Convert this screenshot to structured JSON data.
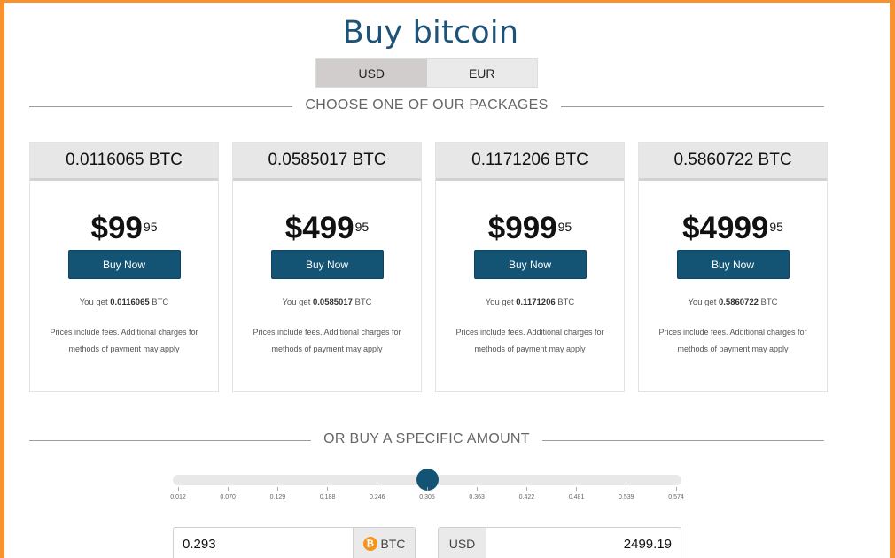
{
  "page": {
    "title": "Buy bitcoin"
  },
  "currency_toggle": {
    "options": [
      "USD",
      "EUR"
    ],
    "selected": "USD"
  },
  "packages_heading": "CHOOSE ONE OF OUR PACKAGES",
  "packages": [
    {
      "btc": "0.0116065 BTC",
      "price_main": "$99",
      "price_cents": "95",
      "button": "Buy Now",
      "you_get_prefix": "You get",
      "you_get_amount": "0.0116065",
      "you_get_unit": "BTC",
      "note": "Prices include fees. Additional charges for methods of payment may apply"
    },
    {
      "btc": "0.0585017 BTC",
      "price_main": "$499",
      "price_cents": "95",
      "button": "Buy Now",
      "you_get_prefix": "You get",
      "you_get_amount": "0.0585017",
      "you_get_unit": "BTC",
      "note": "Prices include fees. Additional charges for methods of payment may apply"
    },
    {
      "btc": "0.1171206 BTC",
      "price_main": "$999",
      "price_cents": "95",
      "button": "Buy Now",
      "you_get_prefix": "You get",
      "you_get_amount": "0.1171206",
      "you_get_unit": "BTC",
      "note": "Prices include fees. Additional charges for methods of payment may apply"
    },
    {
      "btc": "0.5860722 BTC",
      "price_main": "$4999",
      "price_cents": "95",
      "button": "Buy Now",
      "you_get_prefix": "You get",
      "you_get_amount": "0.5860722",
      "you_get_unit": "BTC",
      "note": "Prices include fees. Additional charges for methods of payment may apply"
    }
  ],
  "specific_heading": "OR BUY A SPECIFIC AMOUNT",
  "slider": {
    "ticks": [
      "0.012",
      "0.070",
      "0.129",
      "0.188",
      "0.246",
      "0.305",
      "0.363",
      "0.422",
      "0.481",
      "0.539",
      "0.574"
    ],
    "value_fraction": 0.5
  },
  "btc_input": {
    "value": "0.293",
    "unit": "BTC",
    "icon": "bitcoin-icon"
  },
  "usd_input": {
    "currency": "USD",
    "value": "2499.19"
  },
  "colors": {
    "accent": "#135475",
    "title": "#1d5377",
    "frame": "#f7922f",
    "bitcoin": "#f7931a"
  }
}
